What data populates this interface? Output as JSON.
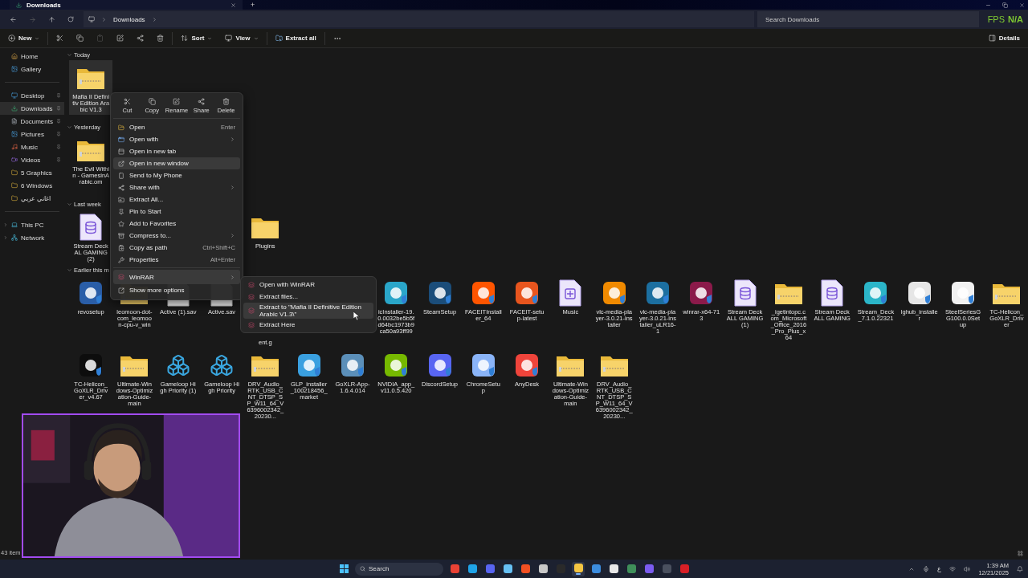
{
  "title_bar": {
    "tab": "Downloads",
    "new_tab": "+"
  },
  "fps": {
    "label": "FPS",
    "value": "N/A"
  },
  "address_bar": {
    "path": [
      "Downloads"
    ],
    "forward_disabled": true
  },
  "search": {
    "placeholder": "Search Downloads"
  },
  "toolbar": {
    "new": "New",
    "sort": "Sort",
    "view": "View",
    "extract": "Extract all",
    "details": "Details",
    "paste_disabled": true
  },
  "sidebar": {
    "groups": [
      [
        {
          "label": "Home",
          "kind": "home",
          "selected": false,
          "pinned": false
        },
        {
          "label": "Gallery",
          "kind": "gallery",
          "selected": false,
          "pinned": false
        }
      ],
      [
        {
          "label": "Desktop",
          "kind": "desktop",
          "selected": false,
          "pinned": true
        },
        {
          "label": "Downloads",
          "kind": "downloads",
          "selected": true,
          "pinned": true
        },
        {
          "label": "Documents",
          "kind": "documents",
          "selected": false,
          "pinned": true
        },
        {
          "label": "Pictures",
          "kind": "pictures",
          "selected": false,
          "pinned": true
        },
        {
          "label": "Music",
          "kind": "music",
          "selected": false,
          "pinned": true
        },
        {
          "label": "Videos",
          "kind": "videos",
          "selected": false,
          "pinned": true
        },
        {
          "label": "5 Graphics",
          "kind": "folder",
          "selected": false,
          "pinned": false
        },
        {
          "label": "6 Windows",
          "kind": "folder",
          "selected": false,
          "pinned": false
        },
        {
          "label": "اغاني عربي",
          "kind": "folder",
          "selected": false,
          "pinned": false
        }
      ],
      [
        {
          "label": "This PC",
          "kind": "pc",
          "selected": false,
          "pinned": false,
          "expanded": false
        },
        {
          "label": "Network",
          "kind": "network",
          "selected": false,
          "pinned": false,
          "expanded": false
        }
      ]
    ]
  },
  "sections": [
    {
      "title": "Today",
      "expanded": true,
      "rows": [
        [
          {
            "label": "Mafia II Definitiv Edition Arabic V1.3",
            "kind": "zip",
            "selected": true
          }
        ]
      ]
    },
    {
      "title": "Yesterday",
      "expanded": true,
      "rows": [
        [
          {
            "label": "The Evil Within - GamesinArabic.om",
            "kind": "zip",
            "selected": false
          }
        ]
      ]
    },
    {
      "title": "Last week",
      "expanded": true,
      "rows": [
        [
          {
            "label": "Stream Deck AL GAMING (2)",
            "kind": "database",
            "selected": false
          },
          {
            "label": "Plugins",
            "kind": "folder",
            "selected": false
          }
        ]
      ]
    },
    {
      "title": "Earlier this m",
      "expanded": true,
      "rows": [
        [
          {
            "label": "revosetup",
            "kind": "app",
            "color": "#2a5ea8",
            "selected": false
          },
          {
            "label": "leomoon-dot-com_leomoon-cpu-v_win",
            "kind": "zip",
            "selected": false
          },
          {
            "label": "Active (1).sav",
            "kind": "document",
            "selected": false
          },
          {
            "label": "Active.sav",
            "kind": "document",
            "selected": false
          },
          {
            "label": "ent.g",
            "kind": "covered",
            "selected": false
          },
          "",
          "",
          {
            "label": "icInstaller-19.0.0032be5b5fd64bc1973b9ca50a93ff99",
            "kind": "app",
            "color": "#2aa6c9",
            "selected": false
          },
          {
            "label": "SteamSetup",
            "kind": "app",
            "color": "#1b4d7a",
            "selected": false
          },
          {
            "label": "FACEITInstaller_64",
            "kind": "app",
            "color": "#ff5500",
            "selected": false
          },
          {
            "label": "FACEIT-setup-latest",
            "kind": "app",
            "color": "#e8551e",
            "selected": false
          },
          {
            "label": "Music",
            "kind": "library",
            "selected": false
          },
          {
            "label": "vlc-media-player-3.0.21-installer",
            "kind": "app",
            "color": "#f08a00",
            "selected": false
          },
          {
            "label": "vlc-media-player-3.0.21-installer_uLR16-1",
            "kind": "app",
            "color": "#1c6fa0",
            "selected": false
          },
          {
            "label": "winrar-x64-713",
            "kind": "app",
            "color": "#8b1a4a",
            "selected": false
          },
          {
            "label": "Stream Deck ALL GAMING (1)",
            "kind": "database",
            "selected": false
          },
          {
            "label": "_igetintopc.com_Microsoft_Office_2016_Pro_Plus_x64",
            "kind": "zip",
            "selected": false
          },
          {
            "label": "Stream Deck ALL GAMING",
            "kind": "database",
            "selected": false
          },
          {
            "label": "Stream_Deck_7.1.0.22321",
            "kind": "app",
            "color": "#2bb5c8",
            "selected": false
          },
          {
            "label": "lghub_installer",
            "kind": "app",
            "color": "#e6e6e6",
            "selected": false
          },
          {
            "label": "SteelSeriesGG100.0.0Setup",
            "kind": "app",
            "color": "#f2f2f2",
            "selected": false
          },
          {
            "label": "TC-Helicon_GoXLR_Driver",
            "kind": "zip",
            "selected": false
          }
        ],
        [
          {
            "label": "TC-Helicon_GoXLR_Driver_v4.67",
            "kind": "app",
            "color": "#0d0d0d",
            "selected": false
          },
          {
            "label": "Ultimate-Windows-Optimization-Guide-main",
            "kind": "zip",
            "selected": false
          },
          {
            "label": "Gameloop High Priority (1)",
            "kind": "registry",
            "selected": false
          },
          {
            "label": "Gameloop High Priority",
            "kind": "registry",
            "selected": false
          },
          {
            "label": "DRV_Audio_RTK_USB_CNT_DTSP_SP_W11_64_V6396002342_20230...",
            "kind": "zip",
            "selected": false
          },
          {
            "label": "GLP_installer_100218456_market",
            "kind": "app",
            "color": "#3aa0e0",
            "selected": false
          },
          {
            "label": "GoXLR-App-1.6.4.014",
            "kind": "app",
            "color": "#5b8fb9",
            "selected": false
          },
          {
            "label": "NVIDIA_app_v11.0.5.420",
            "kind": "app",
            "color": "#76b900",
            "selected": false
          },
          {
            "label": "DiscordSetup",
            "kind": "app",
            "color": "#5865f2",
            "selected": false
          },
          {
            "label": "ChromeSetup",
            "kind": "app",
            "color": "#8ab4f8",
            "selected": false
          },
          {
            "label": "AnyDesk",
            "kind": "app",
            "color": "#ef443b",
            "selected": false
          },
          {
            "label": "Ultimate-Windows-Optimization-Guide-main",
            "kind": "zip",
            "selected": false
          },
          {
            "label": "DRV_Audio_RTK_USB_CNT_DTSP_SP_W11_64_V6396002342_20230...",
            "kind": "zip",
            "selected": false
          }
        ]
      ]
    }
  ],
  "context_menu": {
    "actions": [
      {
        "label": "Cut",
        "kind": "cut"
      },
      {
        "label": "Copy",
        "kind": "copy"
      },
      {
        "label": "Rename",
        "kind": "rename"
      },
      {
        "label": "Share",
        "kind": "share"
      },
      {
        "label": "Delete",
        "kind": "delete"
      }
    ],
    "items": [
      {
        "label": "Open",
        "kind": "open",
        "shortcut": "Enter",
        "submenu": false,
        "selected": false
      },
      {
        "label": "Open with",
        "kind": "open-with",
        "submenu": true,
        "selected": false
      },
      {
        "label": "Open in new tab",
        "kind": "tab",
        "submenu": false,
        "selected": false
      },
      {
        "label": "Open in new window",
        "kind": "window",
        "submenu": false,
        "selected": true
      },
      {
        "label": "Send to My Phone",
        "kind": "phone",
        "submenu": false,
        "selected": false
      },
      {
        "label": "Share with",
        "kind": "share",
        "submenu": true,
        "selected": false
      },
      {
        "label": "Extract All...",
        "kind": "extract",
        "submenu": false,
        "selected": false
      },
      {
        "label": "Pin to Start",
        "kind": "pin",
        "submenu": false,
        "selected": false
      },
      {
        "label": "Add to Favorites",
        "kind": "star",
        "submenu": false,
        "selected": false
      },
      {
        "label": "Compress to...",
        "kind": "compress",
        "submenu": true,
        "selected": false
      },
      {
        "label": "Copy as path",
        "kind": "path",
        "shortcut": "Ctrl+Shift+C",
        "submenu": false,
        "selected": false
      },
      {
        "label": "Properties",
        "kind": "properties",
        "shortcut": "Alt+Enter",
        "submenu": false,
        "selected": false
      },
      {
        "label": "WinRAR",
        "kind": "winrar",
        "submenu": true,
        "selected": true,
        "separator_before": true
      },
      {
        "label": "Show more options",
        "kind": "more",
        "submenu": false,
        "selected": false
      }
    ]
  },
  "submenu": {
    "items": [
      {
        "label": "Open with WinRAR",
        "selected": false
      },
      {
        "label": "Extract files...",
        "selected": false
      },
      {
        "label": "Extract to \"Mafia II Definitive Edition Arabic V1.3\\\"",
        "selected": true
      },
      {
        "label": "Extract Here",
        "selected": false
      }
    ]
  },
  "status_bar": {
    "items": "43 item"
  },
  "taskbar": {
    "search": "Search",
    "apps": [
      {
        "color": "#e94235",
        "selected": false
      },
      {
        "color": "#1fa3e8",
        "selected": false
      },
      {
        "color": "#5865f2",
        "selected": false
      },
      {
        "color": "#66c0f4",
        "selected": false
      },
      {
        "color": "#f25022",
        "selected": false
      },
      {
        "color": "#c8c8c8",
        "selected": false
      },
      {
        "color": "#2a2a2a",
        "selected": false
      },
      {
        "color": "#f4c542",
        "selected": true
      },
      {
        "color": "#3c8de0",
        "selected": false
      },
      {
        "color": "#e8e8e8",
        "selected": false
      },
      {
        "color": "#3f8f5a",
        "selected": false
      },
      {
        "color": "#7b5cf0",
        "selected": false
      },
      {
        "color": "#4a505e",
        "selected": false
      },
      {
        "color": "#d81f26",
        "selected": false
      }
    ],
    "lang": "ع",
    "time": "1:39 AM",
    "date": "12/21/2025"
  }
}
